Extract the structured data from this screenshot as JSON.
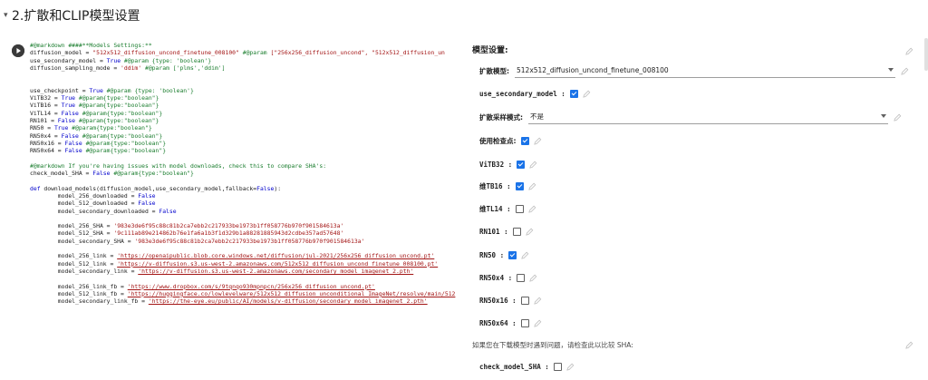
{
  "section": {
    "title": "2.扩散和CLIP模型设置"
  },
  "code_lines": [
    [
      {
        "t": "#@markdown ####**Models Settings:**",
        "c": "com"
      }
    ],
    [
      {
        "t": "diffusion_model = "
      },
      {
        "t": "\"512x512_diffusion_uncond_finetune_008100\"",
        "c": "str"
      },
      {
        "t": " #@param ",
        "c": "com"
      },
      {
        "t": "[\"256x256_diffusion_uncond\", \"512x512_diffusion_un",
        "c": "str"
      }
    ],
    [
      {
        "t": "use_secondary_model = "
      },
      {
        "t": "True",
        "c": "kw"
      },
      {
        "t": " #@param {type: 'boolean'}",
        "c": "com"
      }
    ],
    [
      {
        "t": "diffusion_sampling_mode = "
      },
      {
        "t": "'ddim'",
        "c": "str"
      },
      {
        "t": " #@param ['plms','ddim']",
        "c": "com"
      }
    ],
    [],
    [],
    [
      {
        "t": "use_checkpoint = "
      },
      {
        "t": "True",
        "c": "kw"
      },
      {
        "t": " #@param {type: 'boolean'}",
        "c": "com"
      }
    ],
    [
      {
        "t": "ViTB32 = "
      },
      {
        "t": "True",
        "c": "kw"
      },
      {
        "t": " #@param{type:\"boolean\"}",
        "c": "com"
      }
    ],
    [
      {
        "t": "ViTB16 = "
      },
      {
        "t": "True",
        "c": "kw"
      },
      {
        "t": " #@param{type:\"boolean\"}",
        "c": "com"
      }
    ],
    [
      {
        "t": "ViTL14 = "
      },
      {
        "t": "False",
        "c": "kw"
      },
      {
        "t": " #@param{type:\"boolean\"}",
        "c": "com"
      }
    ],
    [
      {
        "t": "RN101 = "
      },
      {
        "t": "False",
        "c": "kw"
      },
      {
        "t": " #@param{type:\"boolean\"}",
        "c": "com"
      }
    ],
    [
      {
        "t": "RN50 = "
      },
      {
        "t": "True",
        "c": "kw"
      },
      {
        "t": " #@param{type:\"boolean\"}",
        "c": "com"
      }
    ],
    [
      {
        "t": "RN50x4 = "
      },
      {
        "t": "False",
        "c": "kw"
      },
      {
        "t": " #@param{type:\"boolean\"}",
        "c": "com"
      }
    ],
    [
      {
        "t": "RN50x16 = "
      },
      {
        "t": "False",
        "c": "kw"
      },
      {
        "t": " #@param{type:\"boolean\"}",
        "c": "com"
      }
    ],
    [
      {
        "t": "RN50x64 = "
      },
      {
        "t": "False",
        "c": "kw"
      },
      {
        "t": " #@param{type:\"boolean\"}",
        "c": "com"
      }
    ],
    [],
    [
      {
        "t": "#@markdown If you're having issues with model downloads, check this to compare SHA's:",
        "c": "com"
      }
    ],
    [
      {
        "t": "check_model_SHA = "
      },
      {
        "t": "False",
        "c": "kw"
      },
      {
        "t": " #@param{type:\"boolean\"}",
        "c": "com"
      }
    ],
    [],
    [
      {
        "t": "def ",
        "c": "kw"
      },
      {
        "t": "download_models(diffusion_model,use_secondary_model,fallback="
      },
      {
        "t": "False",
        "c": "kw"
      },
      {
        "t": "):"
      }
    ],
    [
      {
        "t": "        model_256_downloaded = "
      },
      {
        "t": "False",
        "c": "kw"
      }
    ],
    [
      {
        "t": "        model_512_downloaded = "
      },
      {
        "t": "False",
        "c": "kw"
      }
    ],
    [
      {
        "t": "        model_secondary_downloaded = "
      },
      {
        "t": "False",
        "c": "kw"
      }
    ],
    [],
    [
      {
        "t": "        model_256_SHA = "
      },
      {
        "t": "'983e3de6f95c88c81b2ca7ebb2c217933be1973b1ff058776b970f901584613a'",
        "c": "str"
      }
    ],
    [
      {
        "t": "        model_512_SHA = "
      },
      {
        "t": "'9c111ab89e214862b76e1fa6a1b3f1d329b1a88281885943d2cdbe357ad57648'",
        "c": "str"
      }
    ],
    [
      {
        "t": "        model_secondary_SHA = "
      },
      {
        "t": "'983e3de6f95c88c81b2ca7ebb2c217933be1973b1ff058776b970f901584613a'",
        "c": "str"
      }
    ],
    [],
    [
      {
        "t": "        model_256_link = "
      },
      {
        "t": "'https://openaipublic.blob.core.windows.net/diffusion/jul-2021/256x256_diffusion_uncond.pt'",
        "c": "link"
      }
    ],
    [
      {
        "t": "        model_512_link = "
      },
      {
        "t": "'https://v-diffusion.s3.us-west-2.amazonaws.com/512x512_diffusion_uncond_finetune_008100.pt'",
        "c": "link"
      }
    ],
    [
      {
        "t": "        model_secondary_link = "
      },
      {
        "t": "'https://v-diffusion.s3.us-west-2.amazonaws.com/secondary_model_imagenet_2.pth'",
        "c": "link"
      }
    ],
    [],
    [
      {
        "t": "        model_256_link_fb = "
      },
      {
        "t": "'https://www.dropbox.com/s/9tqnqo930mpnpcn/256x256_diffusion_uncond.pt'",
        "c": "link"
      }
    ],
    [
      {
        "t": "        model_512_link_fb = "
      },
      {
        "t": "'https://huggingface.co/lowlevelware/512x512_diffusion_unconditional_ImageNet/resolve/main/512",
        "c": "link"
      }
    ],
    [
      {
        "t": "        model_secondary_link_fb = "
      },
      {
        "t": "'https://the-eye.eu/public/AI/models/v-diffusion/secondary_model_imagenet_2.pth'",
        "c": "link"
      }
    ]
  ],
  "form": {
    "title": "模型设置:",
    "diffusion_model": {
      "label": "扩散模型:",
      "value": "512x512_diffusion_uncond_finetune_008100"
    },
    "use_secondary_model": {
      "label": "use_secondary_model :",
      "checked": true
    },
    "sampling_mode": {
      "label": "扩散采样模式:",
      "value": "不是"
    },
    "use_checkpoint": {
      "label": "使用检查点:",
      "checked": true
    },
    "vitb32": {
      "label": "ViTB32 :",
      "checked": true
    },
    "vitb16": {
      "label": "维TB16 :",
      "checked": true
    },
    "vitl14": {
      "label": "维TL14 :",
      "checked": false
    },
    "rn101": {
      "label": "RN101 :",
      "checked": false
    },
    "rn50": {
      "label": "RN50 :",
      "checked": true
    },
    "rn50x4": {
      "label": "RN50x4 :",
      "checked": false
    },
    "rn50x16": {
      "label": "RN50x16 :",
      "checked": false
    },
    "rn50x64": {
      "label": "RN50x64 :",
      "checked": false
    },
    "note": "如果您在下载模型时遇到问题，请检查此以比较 SHA:",
    "check_model_sha": {
      "label": "check_model_SHA :",
      "checked": false
    }
  },
  "colors": {
    "accent": "#1a73e8",
    "comment": "#1a7d2e",
    "string": "#a31515",
    "keyword": "#0000cc"
  },
  "icons": {
    "run": "play-circle-icon",
    "edit": "pencil-icon",
    "caret": "caret-down-icon",
    "dropdown": "dropdown-arrow-icon"
  }
}
